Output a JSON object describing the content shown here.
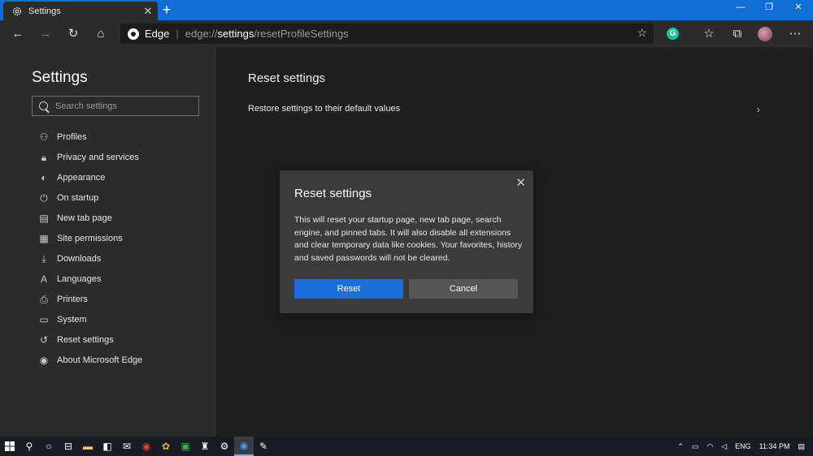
{
  "tab": {
    "title": "Settings",
    "close": "✕",
    "icon": "gear-icon"
  },
  "window_controls": {
    "minimize": "—",
    "restore": "❐",
    "close": "✕"
  },
  "toolbar": {
    "site_name": "Edge",
    "url_scheme": "edge://",
    "url_host": "settings",
    "url_path": "/resetProfileSettings",
    "grammarly": "G"
  },
  "sidebar": {
    "title": "Settings",
    "search_placeholder": "Search settings",
    "items": [
      {
        "label": "Profiles",
        "icon": "person-icon",
        "glyph": "⚇"
      },
      {
        "label": "Privacy and services",
        "icon": "lock-icon",
        "glyph": "🔒︎"
      },
      {
        "label": "Appearance",
        "icon": "palette-icon",
        "glyph": "◐"
      },
      {
        "label": "On startup",
        "icon": "power-icon",
        "glyph": "⏻"
      },
      {
        "label": "New tab page",
        "icon": "newtab-icon",
        "glyph": "▤"
      },
      {
        "label": "Site permissions",
        "icon": "permissions-icon",
        "glyph": "▦"
      },
      {
        "label": "Downloads",
        "icon": "download-icon",
        "glyph": "⤓"
      },
      {
        "label": "Languages",
        "icon": "languages-icon",
        "glyph": "A"
      },
      {
        "label": "Printers",
        "icon": "printer-icon",
        "glyph": "⎙"
      },
      {
        "label": "System",
        "icon": "laptop-icon",
        "glyph": "▭"
      },
      {
        "label": "Reset settings",
        "icon": "reset-icon",
        "glyph": "↺"
      },
      {
        "label": "About Microsoft Edge",
        "icon": "edge-icon",
        "glyph": "◉"
      }
    ]
  },
  "main": {
    "title": "Reset settings",
    "row_label": "Restore settings to their default values"
  },
  "dialog": {
    "title": "Reset settings",
    "body": "This will reset your startup page, new tab page, search engine, and pinned tabs. It will also disable all extensions and clear temporary data like cookies. Your favorites, history and saved passwords will not be cleared.",
    "reset_label": "Reset",
    "cancel_label": "Cancel"
  },
  "taskbar": {
    "language": "ENG",
    "time": "11:34 PM"
  },
  "colors": {
    "accent": "#0f6ed3",
    "primary_button": "#1c6fd8",
    "background": "#1f1f1f",
    "panel": "#2b2b2b"
  }
}
